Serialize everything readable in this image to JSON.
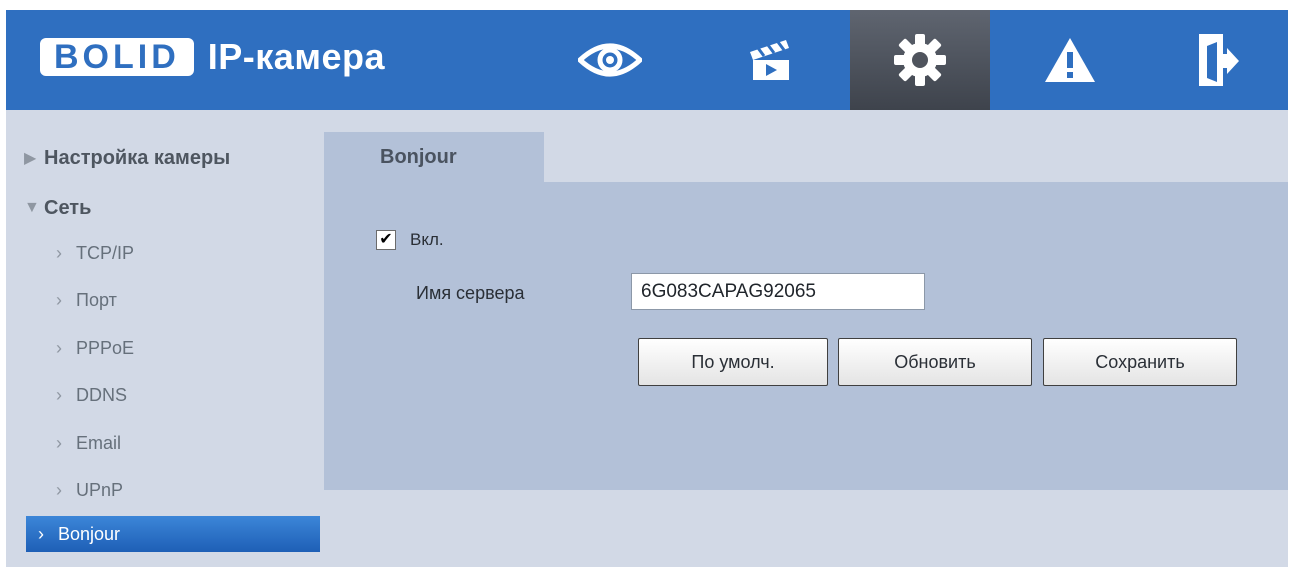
{
  "header": {
    "logo_text": "BOLID",
    "title": "IP-камера",
    "nav": [
      {
        "icon": "eye-icon",
        "active": false
      },
      {
        "icon": "clapperboard-icon",
        "active": false
      },
      {
        "icon": "gear-icon",
        "active": true
      },
      {
        "icon": "warning-icon",
        "active": false
      },
      {
        "icon": "logout-icon",
        "active": false
      }
    ]
  },
  "sidebar": {
    "sections": [
      {
        "label": "Настройка камеры",
        "expanded": false
      },
      {
        "label": "Сеть",
        "expanded": true
      }
    ],
    "items": [
      {
        "label": "TCP/IP"
      },
      {
        "label": "Порт"
      },
      {
        "label": "PPPoE"
      },
      {
        "label": "DDNS"
      },
      {
        "label": "Email"
      },
      {
        "label": "UPnP"
      },
      {
        "label": "Bonjour",
        "active": true
      }
    ]
  },
  "content": {
    "tab": "Bonjour",
    "enable": {
      "label": "Вкл.",
      "checked": true
    },
    "server_name": {
      "label": "Имя сервера",
      "value": "6G083CAPAG92065"
    },
    "buttons": {
      "default": "По умолч.",
      "refresh": "Обновить",
      "save": "Сохранить"
    }
  },
  "colors": {
    "header_blue": "#2f6fc0",
    "panel_bg": "#b3c1d8",
    "page_bg": "#d2d9e6",
    "active_item": "#2a74cc"
  }
}
